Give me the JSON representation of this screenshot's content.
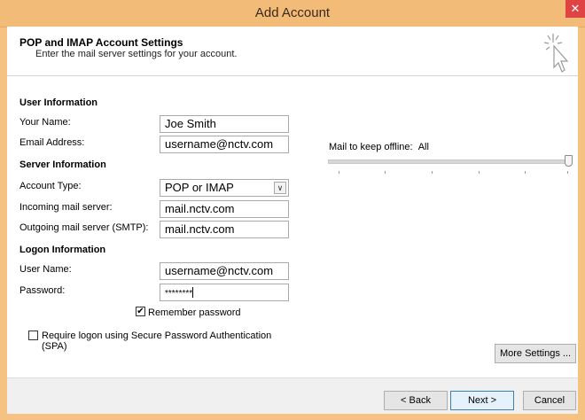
{
  "window": {
    "title": "Add Account",
    "close_label": "✕"
  },
  "header": {
    "title": "POP and IMAP Account Settings",
    "subtitle": "Enter the mail server settings for your account."
  },
  "user_info": {
    "section_label": "User Information",
    "name_label": "Your Name:",
    "name_value": "Joe Smith",
    "email_label": "Email Address:",
    "email_value": "username@nctv.com"
  },
  "server_info": {
    "section_label": "Server Information",
    "account_type_label": "Account Type:",
    "account_type_value": "POP or IMAP",
    "incoming_label": "Incoming mail server:",
    "incoming_value": "mail.nctv.com",
    "outgoing_label": "Outgoing mail server (SMTP):",
    "outgoing_value": "mail.nctv.com"
  },
  "logon_info": {
    "section_label": "Logon Information",
    "user_name_label": "User Name:",
    "user_name_value": "username@nctv.com",
    "password_label": "Password:",
    "password_value": "********",
    "remember_label": "Remember password",
    "remember_checked": true,
    "spa_label_line1": "Require logon using Secure Password Authentication",
    "spa_label_line2": "(SPA)",
    "spa_checked": false
  },
  "offline": {
    "label": "Mail to keep offline:",
    "value": "All"
  },
  "buttons": {
    "more_settings": "More Settings ...",
    "back": "< Back",
    "next": "Next >",
    "cancel": "Cancel"
  }
}
